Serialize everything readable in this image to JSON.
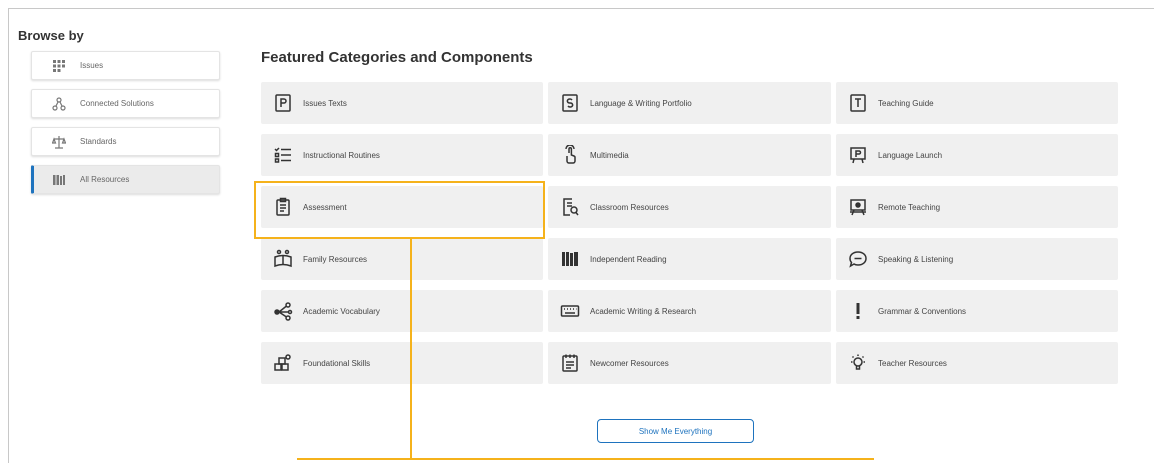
{
  "browse": {
    "title": "Browse by",
    "items": [
      {
        "label": "Issues",
        "icon": "grid-icon",
        "active": false
      },
      {
        "label": "Connected Solutions",
        "icon": "network-icon",
        "active": false
      },
      {
        "label": "Standards",
        "icon": "scale-icon",
        "active": false
      },
      {
        "label": "All Resources",
        "icon": "books-icon",
        "active": true
      }
    ]
  },
  "featured": {
    "title": "Featured Categories and Components",
    "tiles": [
      {
        "label": "Issues Texts",
        "icon": "book-p-icon"
      },
      {
        "label": "Language & Writing Portfolio",
        "icon": "book-s-icon"
      },
      {
        "label": "Teaching Guide",
        "icon": "book-t-icon"
      },
      {
        "label": "Instructional Routines",
        "icon": "checklist-icon"
      },
      {
        "label": "Multimedia",
        "icon": "touch-icon"
      },
      {
        "label": "Language Launch",
        "icon": "presentation-p-icon"
      },
      {
        "label": "Assessment",
        "icon": "clipboard-icon"
      },
      {
        "label": "Classroom Resources",
        "icon": "document-search-icon"
      },
      {
        "label": "Remote Teaching",
        "icon": "easel-icon"
      },
      {
        "label": "Family Resources",
        "icon": "family-book-icon"
      },
      {
        "label": "Independent Reading",
        "icon": "bookshelf-icon"
      },
      {
        "label": "Speaking & Listening",
        "icon": "speech-bubble-icon"
      },
      {
        "label": "Academic Vocabulary",
        "icon": "word-web-icon"
      },
      {
        "label": "Academic Writing & Research",
        "icon": "keyboard-icon"
      },
      {
        "label": "Grammar & Conventions",
        "icon": "exclamation-icon"
      },
      {
        "label": "Foundational Skills",
        "icon": "blocks-icon"
      },
      {
        "label": "Newcomer Resources",
        "icon": "calendar-doc-icon"
      },
      {
        "label": "Teacher Resources",
        "icon": "lightbulb-icon"
      }
    ]
  },
  "show_button": "Show Me Everything",
  "colors": {
    "accent": "#1e73be",
    "highlight": "#f5b21b",
    "tile_bg": "#f0f0f0"
  }
}
